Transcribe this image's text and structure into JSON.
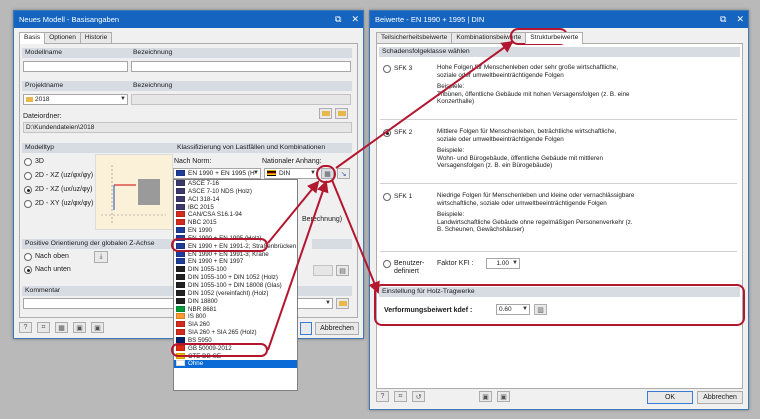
{
  "left": {
    "title": "Neues Modell - Basisangaben",
    "tabs": [
      "Basis",
      "Optionen",
      "Historie"
    ],
    "modellname_label": "Modellname",
    "bezeichnung_label": "Bezeichnung",
    "projektname_label": "Projektname",
    "projekt_value": "2018",
    "bezeichnung2_label": "Bezeichnung",
    "dateiordner_label": "Dateiordner:",
    "dateiordner_value": "D:\\Kundendateien\\2018",
    "modelltyp_label": "Modelltyp",
    "modelltyp_options": [
      "3D",
      "2D - XZ (uz/φx/φy)",
      "2D - XZ (ux/uz/φy)",
      "2D - XY (uz/φx/φy)"
    ],
    "klass_label": "Klassifizierung von Lastfällen und Kombinationen",
    "norm_label": "Nach Norm:",
    "norm_value": "EN 1990 + EN 1995 (H",
    "anhang_label": "Nationaler Anhang:",
    "anhang_value": "DIN",
    "berechnung_fragment": "Berechnung)",
    "zachse_label": "Positive Orientierung der globalen Z-Achse",
    "z_options": [
      "Nach oben",
      "Nach unten"
    ],
    "kommentar_label": "Kommentar",
    "cancel_label": "Abbrechen",
    "norms": [
      {
        "label": "ASCE 7-16",
        "color": "#3c3b6e"
      },
      {
        "label": "ASCE 7-10 NDS (Holz)",
        "color": "#3c3b6e"
      },
      {
        "label": "ACI 318-14",
        "color": "#3c3b6e"
      },
      {
        "label": "IBC 2015",
        "color": "#3c3b6e"
      },
      {
        "label": "CAN/CSA S16.1-94",
        "color": "#d52b1e"
      },
      {
        "label": "NBC 2015",
        "color": "#d52b1e"
      },
      {
        "label": "EN 1990",
        "color": "#1f3c99"
      },
      {
        "label": "EN 1990 + EN 1995 (Holz)",
        "color": "#1f3c99"
      },
      {
        "label": "EN 1990 + EN 1991-2; Straßenbrücken",
        "color": "#1f3c99"
      },
      {
        "label": "EN 1990 + EN 1991-3; Krane",
        "color": "#1f3c99"
      },
      {
        "label": "EN 1990 + EN 1997",
        "color": "#1f3c99"
      },
      {
        "label": "DIN 1055-100",
        "color": "#222222"
      },
      {
        "label": "DIN 1055-100 + DIN 1052 (Holz)",
        "color": "#222222"
      },
      {
        "label": "DIN 1055-100 + DIN 18008 (Glas)",
        "color": "#222222"
      },
      {
        "label": "DIN 1052 (vereinfacht) (Holz)",
        "color": "#222222"
      },
      {
        "label": "DIN 18800",
        "color": "#222222"
      },
      {
        "label": "NBR 8681",
        "color": "#009c3b"
      },
      {
        "label": "IS 800",
        "color": "#ff9933"
      },
      {
        "label": "SIA 260",
        "color": "#d52b1e"
      },
      {
        "label": "SIA 260 + SIA 265 (Holz)",
        "color": "#d52b1e"
      },
      {
        "label": "BS 5950",
        "color": "#012169"
      },
      {
        "label": "GB 50009-2012",
        "color": "#de2910"
      },
      {
        "label": "CTE DB-SE",
        "color": "#f1bf00"
      },
      {
        "label": "Ohne",
        "color": "#ffffff"
      }
    ],
    "selected_norm_index": 23
  },
  "right": {
    "title": "Beiwerte - EN 1990 + 1995 | DIN",
    "tabs": [
      "Teilsicherheitsbeiwerte",
      "Kombinationsbeiwerte",
      "Strukturbeiwerte"
    ],
    "schaden_label": "Schadensfolgeklasse wählen",
    "sfk": [
      {
        "name": "SFK 3",
        "desc1": "Hohe Folgen für Menschenleben oder sehr große wirtschaftliche,",
        "desc2": "soziale oder umweltbeeinträchtigende Folgen",
        "bsp": "Beispiele:",
        "ex1": "Tribünen, öffentliche Gebäude mit hohen Versagensfolgen (z. B. eine",
        "ex2": "Konzerthalle)"
      },
      {
        "name": "SFK 2",
        "desc1": "Mittlere Folgen für Menschenleben, beträchtliche wirtschaftliche,",
        "desc2": "soziale oder umweltbeeinträchtigende Folgen",
        "bsp": "Beispiele:",
        "ex1": "Wohn- und Bürogebäude, öffentliche Gebäude mit mittleren",
        "ex2": "Versagensfolgen (z. B. ein Bürogebäude)"
      },
      {
        "name": "SFK 1",
        "desc1": "Niedrige Folgen für Menschenleben und kleine oder vernachlässigbare",
        "desc2": "wirtschaftliche, soziale oder umweltbeeinträchtigende Folgen",
        "bsp": "Beispiele:",
        "ex1": "Landwirtschaftliche Gebäude ohne regelmäßigen Personenverkehr (z.",
        "ex2": "B. Scheunen, Gewächshäuser)"
      }
    ],
    "benutzer_label1": "Benutzer-",
    "benutzer_label2": "definiert",
    "faktor_label": "Faktor KFI :",
    "faktor_value": "1.00",
    "holz_label": "Einstellung für Holz-Tragwerke",
    "kdef_label": "Verformungsbeiwert kdef :",
    "kdef_value": "0.60",
    "ok_label": "OK",
    "cancel_label": "Abbrechen"
  },
  "highlight_color": "#b3172f"
}
